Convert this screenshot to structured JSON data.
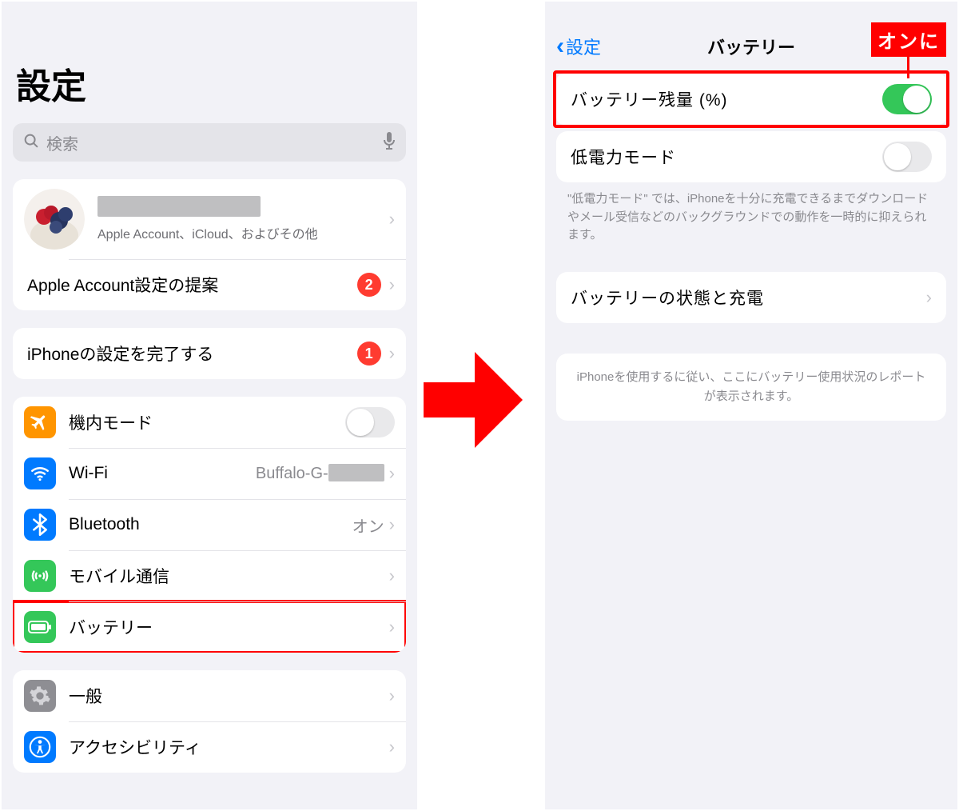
{
  "left": {
    "title": "設定",
    "search_placeholder": "検索",
    "account_sub": "Apple Account、iCloud、およびその他",
    "suggestions_label": "Apple Account設定の提案",
    "suggestions_badge": "2",
    "finish_setup_label": "iPhoneの設定を完了する",
    "finish_setup_badge": "1",
    "items": {
      "airplane": "機内モード",
      "wifi": "Wi-Fi",
      "wifi_value_prefix": "Buffalo-G-",
      "bluetooth": "Bluetooth",
      "bluetooth_value": "オン",
      "cellular": "モバイル通信",
      "battery": "バッテリー",
      "general": "一般",
      "accessibility": "アクセシビリティ"
    }
  },
  "right": {
    "back": "設定",
    "title": "バッテリー",
    "callout": "オンに",
    "percent_label": "バッテリー残量 (%)",
    "lowpower_label": "低電力モード",
    "lowpower_note": "\"低電力モード\" では、iPhoneを十分に充電できるまでダウンロードやメール受信などのバックグラウンドでの動作を一時的に抑えられます。",
    "health_label": "バッテリーの状態と充電",
    "usage_note": "iPhoneを使用するに従い、ここにバッテリー使用状況のレポートが表示されます。"
  }
}
